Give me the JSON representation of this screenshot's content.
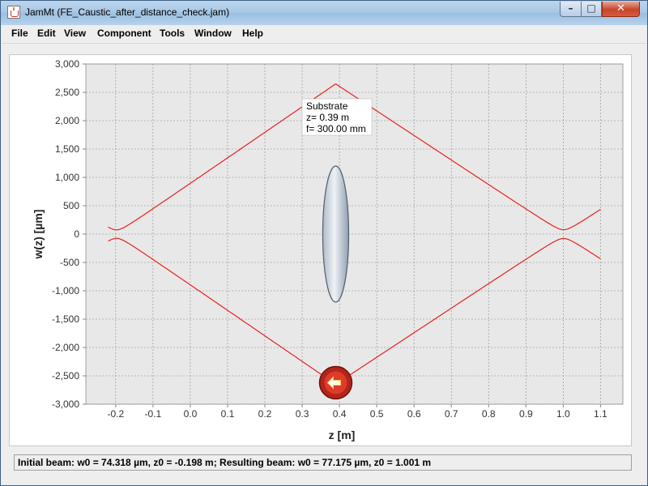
{
  "window": {
    "title": "JamMt (FE_Caustic_after_distance_check.jam)"
  },
  "controls": {
    "minimize": "–",
    "maximize": "□",
    "close": "✕"
  },
  "menu": [
    {
      "label": "File"
    },
    {
      "label": "Edit"
    },
    {
      "label": "View"
    },
    {
      "label": "Component"
    },
    {
      "label": "Tools"
    },
    {
      "label": "Window"
    },
    {
      "label": "Help"
    }
  ],
  "plot": {
    "xlabel": "z [m]",
    "ylabel": "w(z) [µm]",
    "xlim": [
      -0.28,
      1.16
    ],
    "ylim": [
      -3000,
      3000
    ],
    "xticks": [
      -0.2,
      -0.1,
      0.0,
      0.1,
      0.2,
      0.3,
      0.4,
      0.5,
      0.6,
      0.7,
      0.8,
      0.9,
      1.0,
      1.1
    ],
    "xtick_labels": [
      "-0.2",
      "-0.1",
      "0.0",
      "0.1",
      "0.2",
      "0.3",
      "0.4",
      "0.5",
      "0.6",
      "0.7",
      "0.8",
      "0.9",
      "1.0",
      "1.1"
    ],
    "yticks": [
      -3000,
      -2500,
      -2000,
      -1500,
      -1000,
      -500,
      0,
      500,
      1000,
      1500,
      2000,
      2500,
      3000
    ],
    "ytick_labels": [
      "-3,000",
      "-2,500",
      "-2,000",
      "-1,500",
      "-1,000",
      "-500",
      "0",
      "500",
      "1,000",
      "1,500",
      "2,000",
      "2,500",
      "3,000"
    ],
    "grid": true,
    "beam_color": "#e8211d",
    "lens": {
      "z": 0.39,
      "half_height_um": 1200
    },
    "tooltip": {
      "line1": "Substrate",
      "line2": "z= 0.39 m",
      "line3": "f= 300.00 mm"
    },
    "beam": {
      "w0_initial_um": 74.318,
      "z0_initial_m": -0.198,
      "w0_result_um": 77.175,
      "z0_result_m": 1.001,
      "z_start_m": -0.22,
      "z_end_m": 1.1,
      "max_width_um": 2650
    }
  },
  "status": {
    "text": "Initial beam: w0 = 74.318 µm, z0 = -0.198 m; Resulting beam: w0 = 77.175 µm, z0 = 1.001 m"
  }
}
